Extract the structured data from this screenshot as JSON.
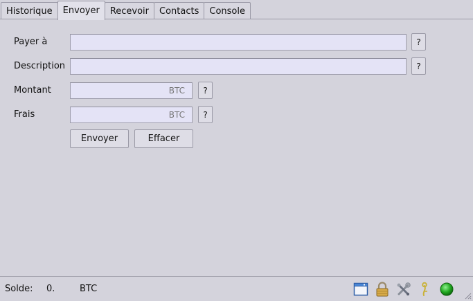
{
  "tabs": [
    {
      "label": "Historique"
    },
    {
      "label": "Envoyer"
    },
    {
      "label": "Recevoir"
    },
    {
      "label": "Contacts"
    },
    {
      "label": "Console"
    }
  ],
  "active_tab": "Envoyer",
  "form": {
    "pay_to_label": "Payer à",
    "pay_to_value": "",
    "description_label": "Description",
    "description_value": "",
    "amount_label": "Montant",
    "amount_placeholder": "BTC",
    "fee_label": "Frais",
    "fee_placeholder": "BTC",
    "help_label": "?",
    "send_label": "Envoyer",
    "clear_label": "Effacer"
  },
  "status": {
    "balance_label": "Solde:",
    "balance_value": "0.",
    "balance_unit": "BTC",
    "icons": [
      "wallet-window-icon",
      "lock-icon",
      "preferences-tools-icon",
      "seed-icon",
      "network-status-icon"
    ],
    "network_color": "#22aa22"
  }
}
